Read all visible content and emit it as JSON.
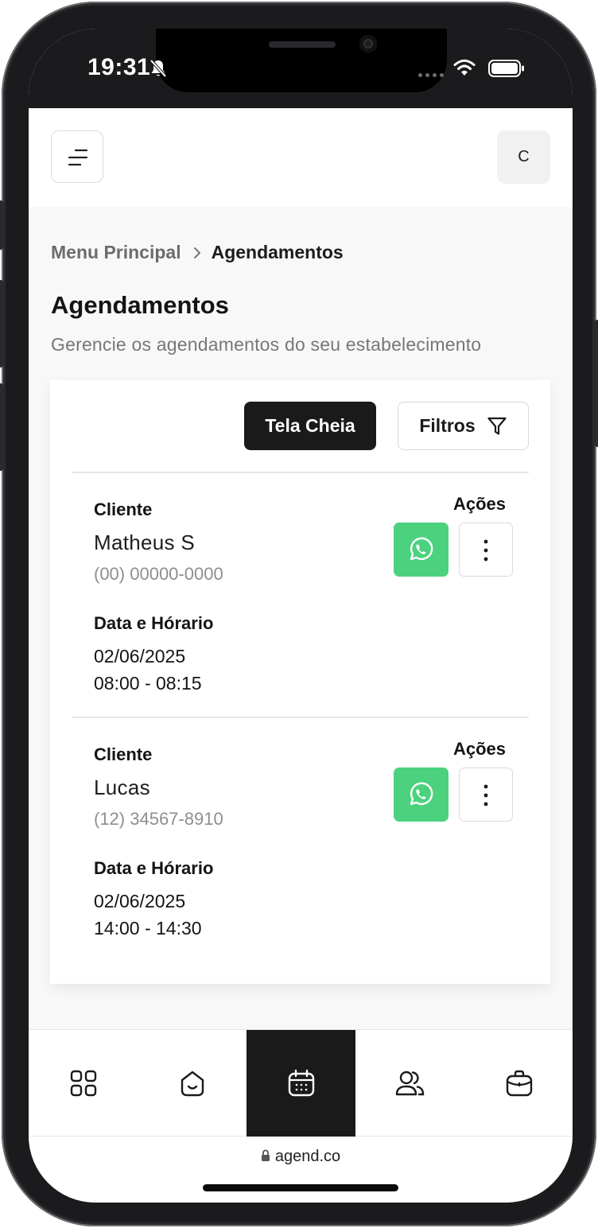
{
  "status_bar": {
    "time": "19:31"
  },
  "header": {
    "avatar_initial": "C"
  },
  "breadcrumb": {
    "root": "Menu Principal",
    "current": "Agendamentos"
  },
  "page": {
    "title": "Agendamentos",
    "subtitle": "Gerencie os agendamentos do seu estabelecimento"
  },
  "toolbar": {
    "fullscreen_label": "Tela Cheia",
    "filters_label": "Filtros"
  },
  "appointments": [
    {
      "client_label": "Cliente",
      "client_name": "Matheus S",
      "client_phone": "(00) 00000-0000",
      "actions_label": "Ações",
      "datetime_label": "Data e Hórario",
      "date": "02/06/2025",
      "time": "08:00 - 08:15"
    },
    {
      "client_label": "Cliente",
      "client_name": "Lucas",
      "client_phone": "(12) 34567-8910",
      "actions_label": "Ações",
      "datetime_label": "Data e Hórario",
      "date": "02/06/2025",
      "time": "14:00 - 14:30"
    }
  ],
  "bottom_nav": {
    "items": [
      {
        "icon": "grid-icon",
        "active": false
      },
      {
        "icon": "home-icon",
        "active": false
      },
      {
        "icon": "calendar-icon",
        "active": true
      },
      {
        "icon": "users-icon",
        "active": false
      },
      {
        "icon": "briefcase-icon",
        "active": false
      }
    ]
  },
  "browser": {
    "url": "agend.co"
  },
  "colors": {
    "whatsapp": "#4cd27f",
    "primary_dark": "#1a1a1a",
    "page_background": "#f8f8f8"
  }
}
